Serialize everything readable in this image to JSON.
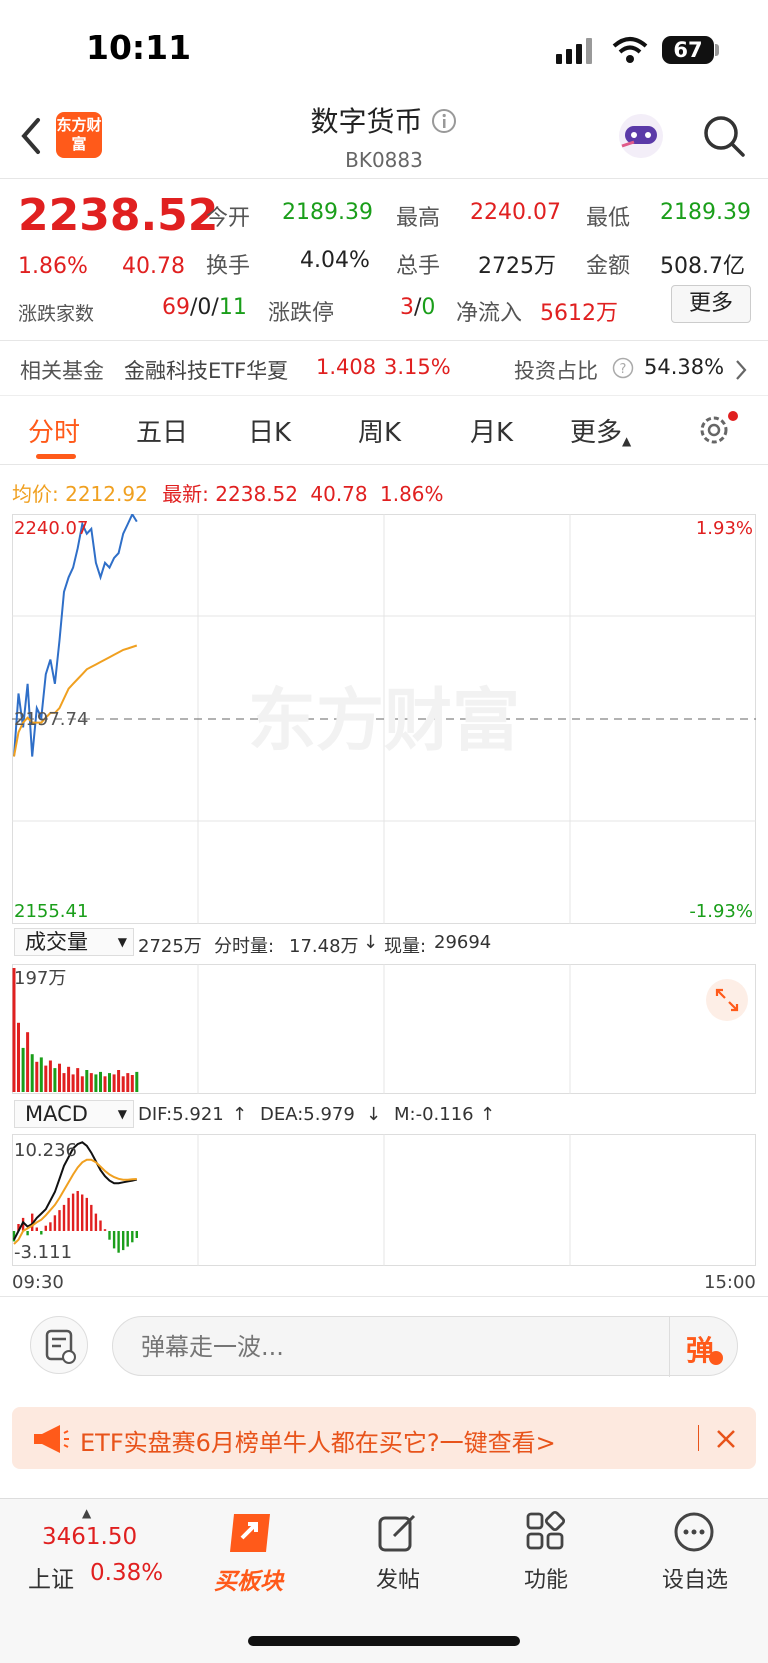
{
  "status_bar": {
    "time": "10:11",
    "battery": "67"
  },
  "header": {
    "logo_text": "东方财富",
    "title": "数字货币",
    "code": "BK0883"
  },
  "quote": {
    "price": "2238.52",
    "change_pct": "1.86%",
    "change": "40.78",
    "open_label": "今开",
    "open": "2189.39",
    "high_label": "最高",
    "high": "2240.07",
    "low_label": "最低",
    "low": "2189.39",
    "turnover_label": "换手",
    "turnover": "4.04%",
    "volume_label": "总手",
    "volume": "2725万",
    "amount_label": "金额",
    "amount": "508.7亿",
    "updown_label": "涨跌家数",
    "up_count": "69",
    "flat_count": "0",
    "down_count": "11",
    "limit_label": "涨跌停",
    "limit_up": "3",
    "limit_down": "0",
    "netflow_label": "净流入",
    "netflow": "5612万",
    "more_label": "更多"
  },
  "fund": {
    "label": "相关基金",
    "name": "金融科技ETF华夏",
    "price": "1.408",
    "pct": "3.15%",
    "ratio_label": "投资占比",
    "ratio": "54.38%"
  },
  "tabs": [
    "分时",
    "五日",
    "日K",
    "周K",
    "月K",
    "更多"
  ],
  "active_tab": "分时",
  "intraday": {
    "avg_label": "均价:",
    "avg": "2212.92",
    "latest_label": "最新:",
    "latest": "2238.52",
    "latest_change": "40.78",
    "latest_pct": "1.86%",
    "y_top": "2240.07",
    "y_mid": "2197.74",
    "y_bottom": "2155.41",
    "pct_top": "1.93%",
    "pct_bottom": "-1.93%",
    "watermark": "东方财富"
  },
  "volume_panel": {
    "selector": "成交量",
    "total": "2725万",
    "minute_label": "分时量:",
    "minute": "17.48万",
    "now_label": "现量:",
    "now": "29694",
    "axis_top": "197万"
  },
  "macd_panel": {
    "selector": "MACD",
    "dif": "DIF:5.921",
    "dea": "DEA:5.979",
    "m": "M:-0.116",
    "axis_top": "10.236",
    "axis_bottom": "-3.111"
  },
  "time_axis": {
    "start": "09:30",
    "end": "15:00"
  },
  "comment": {
    "placeholder": "弹幕走一波...",
    "danmu": "弹"
  },
  "banner": {
    "text": "ETF实盘赛6月榜单牛人都在买它?一键查看>"
  },
  "bottom_nav": {
    "index_value": "3461.50",
    "index_name": "上证",
    "index_pct": "0.38%",
    "buy_label": "买板块",
    "post_label": "发帖",
    "func_label": "功能",
    "watch_label": "设自选"
  },
  "chart_data": {
    "type": "line",
    "title": "",
    "xlabel": "",
    "ylabel": "",
    "x_range": [
      "09:30",
      "15:00"
    ],
    "ylim": [
      2155.41,
      2240.07
    ],
    "prev_close": 2197.74,
    "series": [
      {
        "name": "最新",
        "color": "#2f6fc8",
        "values": [
          2190,
          2203,
          2196,
          2205,
          2190,
          2200,
          2198,
          2207,
          2210,
          2205,
          2214,
          2224,
          2227,
          2229,
          2233,
          2238,
          2236,
          2237,
          2230,
          2227,
          2230,
          2229,
          2231,
          2232,
          2236,
          2238,
          2240,
          2238.5
        ]
      },
      {
        "name": "均价",
        "color": "#f0a020",
        "values": [
          2190,
          2195,
          2197,
          2198,
          2197,
          2197,
          2197,
          2198,
          2199,
          2199,
          2200,
          2202,
          2204,
          2205,
          2206,
          2207,
          2208,
          2208.5,
          2209,
          2209.5,
          2210,
          2210.5,
          2211,
          2211.5,
          2212,
          2212.3,
          2212.6,
          2212.92
        ]
      }
    ],
    "volume": [
      197,
      110,
      70,
      95,
      60,
      48,
      55,
      42,
      50,
      38,
      45,
      30,
      40,
      28,
      38,
      25,
      35,
      30,
      28,
      32,
      25,
      30,
      28,
      35,
      25,
      30,
      27,
      32
    ],
    "macd_hist": [
      -1.2,
      0.8,
      1.5,
      -0.5,
      2.0,
      0.4,
      -0.4,
      0.6,
      1.0,
      1.8,
      2.4,
      3.0,
      3.8,
      4.3,
      4.6,
      4.2,
      3.8,
      3.0,
      2.0,
      1.2,
      0.2,
      -1.0,
      -2.0,
      -2.5,
      -2.2,
      -1.8,
      -1.3,
      -0.8
    ],
    "macd_dif": [
      -1,
      0,
      1,
      0.5,
      0.8,
      1.5,
      2.0,
      2.5,
      3.5,
      4.5,
      6.0,
      7.5,
      8.5,
      9.5,
      10.0,
      10.2,
      9.8,
      9.0,
      8.0,
      7.0,
      6.3,
      5.8,
      5.5,
      5.5,
      5.6,
      5.7,
      5.8,
      5.921
    ],
    "macd_dea": [
      -1.5,
      -1,
      0,
      0.3,
      0.6,
      1.0,
      1.3,
      1.8,
      2.4,
      3.0,
      3.8,
      4.7,
      5.6,
      6.5,
      7.3,
      7.9,
      8.2,
      8.2,
      7.9,
      7.4,
      6.9,
      6.5,
      6.2,
      6.0,
      5.9,
      5.9,
      5.95,
      5.979
    ]
  }
}
